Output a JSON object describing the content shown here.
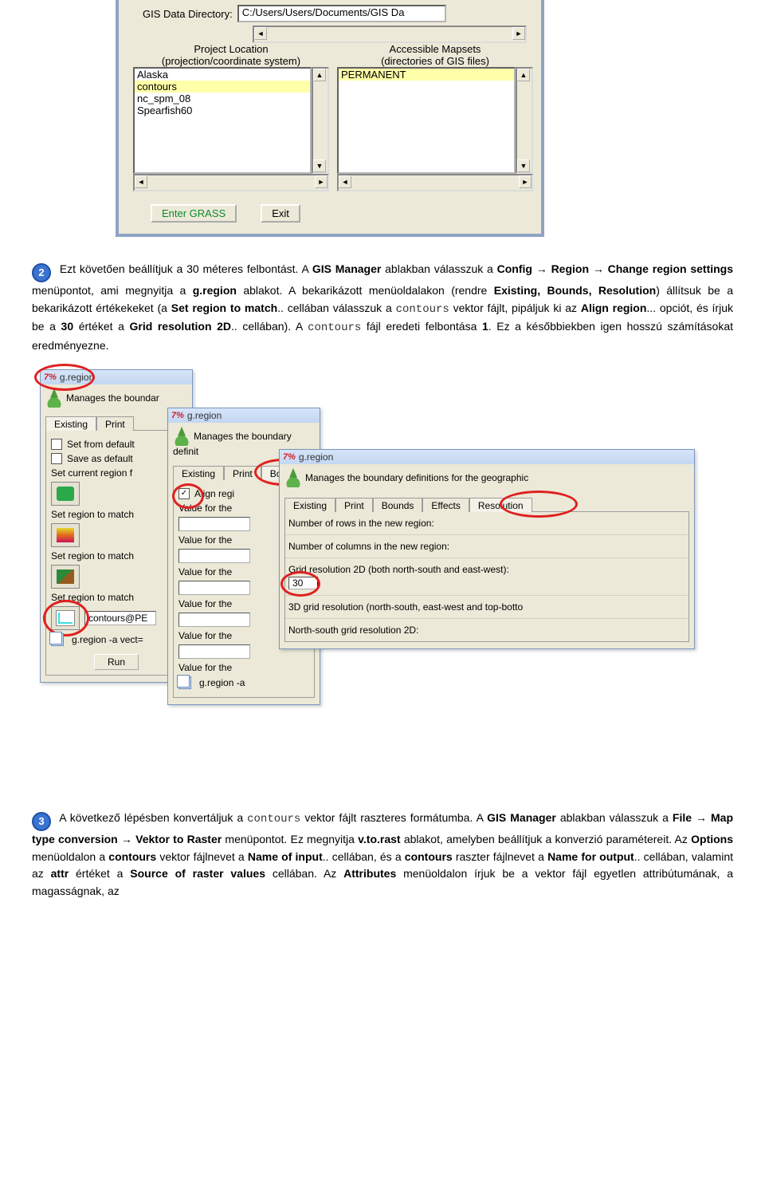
{
  "topPanel": {
    "gisDirLabel": "GIS Data Directory:",
    "gisDirValue": "C:/Users/Users/Documents/GIS Da",
    "leftHeader1": "Project Location",
    "leftHeader2": "(projection/coordinate system)",
    "rightHeader1": "Accessible Mapsets",
    "rightHeader2": "(directories of GIS files)",
    "leftItems": [
      "Alaska",
      "contours",
      "nc_spm_08",
      "Spearfish60"
    ],
    "leftSelectedIndex": 1,
    "rightItems": [
      "PERMANENT"
    ],
    "rightSelectedIndex": 0,
    "btnEnter": "Enter GRASS",
    "btnExit": "Exit"
  },
  "step2": {
    "num": "2",
    "t1": "Ezt követően beállítjuk a 30 méteres felbontást. A ",
    "b1": "GIS Manager",
    "t2": " ablakban válasszuk a ",
    "b2": "Config",
    "arrow": " → ",
    "b3": "Region",
    "b4": "Change region settings",
    "t3": " menüpontot, ami megnyitja a ",
    "b5": "g.region",
    "t4": " ablakot. A bekarikázott menüoldalakon (rendre ",
    "b6": "Existing, Bounds, Resolution",
    "t5": ") állítsuk be a bekarikázott értékekeket (a ",
    "b7": "Set region to match",
    "t6": ".. cellában válasszuk a ",
    "m1": "contours",
    "t7": " vektor fájlt, pipáljuk ki az ",
    "b8": "Align region",
    "t8": "... opciót, és írjuk be a ",
    "b9": "30",
    "t9": " értéket a ",
    "b10": "Grid resolution 2D",
    "t10": ".. cellában). A ",
    "m2": "contours",
    "t11": " fájl eredeti felbontása ",
    "b11": "1",
    "t12": ". Ez a későbbiekben igen hosszú számításokat eredményezne."
  },
  "win1": {
    "title": "g.region",
    "manages": "Manages the boundar",
    "tabs": [
      "Existing",
      "Print"
    ],
    "chk1": "Set from default",
    "chk2": "Save as default",
    "lblCurrent": "Set current region f",
    "lblMatch": "Set region to match",
    "contoursVal": "contours@PE",
    "cmd": "g.region -a vect=",
    "run": "Run"
  },
  "win2": {
    "title": "g.region",
    "manages": "Manages the boundary definit",
    "tabs": [
      "Existing",
      "Print",
      "Bounds"
    ],
    "alignLbl": "Align regi",
    "valueLbl": "Value for the",
    "cmd": "g.region -a"
  },
  "win3": {
    "title": "g.region",
    "manages": "Manages the boundary definitions for the geographic",
    "tabs": [
      "Existing",
      "Print",
      "Bounds",
      "Effects",
      "Resolution"
    ],
    "rows": "Number of rows in the new region:",
    "cols": "Number of columns in the new region:",
    "grid2d": "Grid resolution 2D (both north-south and east-west):",
    "grid2dVal": "30",
    "grid3d": "3D grid resolution (north-south, east-west and top-botto",
    "ns2d": "North-south grid resolution 2D:"
  },
  "step3": {
    "num": "3",
    "t1": "A következő lépésben konvertáljuk a ",
    "m1": "contours",
    "t2": " vektor fájlt raszteres formátumba. A ",
    "b1": "GIS Manager",
    "t3": " ablakban válasszuk a ",
    "b2": "File",
    "b3": "Map type conversion",
    "b4": "Vektor to Raster",
    "t4": " menüpontot. Ez megnyitja ",
    "b5": "v.to.rast",
    "t5": " ablakot, amelyben beállítjuk a konverzió paramétereit. Az ",
    "b6": "Options",
    "t6": " menüoldalon a ",
    "b7": "contours",
    "t7": " vektor fájlnevet a ",
    "b8": "Name of input",
    "t8": ".. cellában, és a ",
    "b9": "contours",
    "t9": "  raszter fájlnevet a ",
    "b10": "Name for output",
    "t10": ".. cellában, valamint az ",
    "b11": "attr",
    "t11": " értéket a  ",
    "b12": "Source of raster values",
    "t12": "  cellában. Az ",
    "b13": "Attributes",
    "t13": " menüoldalon írjuk be a vektor fájl egyetlen attribútumának, a magasságnak, az"
  }
}
